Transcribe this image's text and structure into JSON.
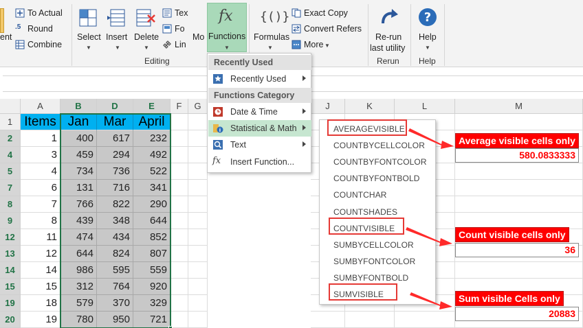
{
  "ribbon": {
    "left_group": {
      "to_actual": "To Actual",
      "round": "Round",
      "combine": "Combine",
      "cut_label": "ent"
    },
    "editing": {
      "select": "Select",
      "insert": "Insert",
      "delete": "Delete",
      "text": "Tex",
      "format": "Fo",
      "link": "Lin",
      "more": "Mo",
      "functions": "Functions",
      "group_label": "Editing"
    },
    "formulas": {
      "label": "Formulas",
      "exact_copy": "Exact Copy",
      "convert_refs": "Convert Refers",
      "more": "More"
    },
    "rerun": {
      "label_line1": "Re-run",
      "label_line2": "last utility",
      "group_label": "Rerun"
    },
    "help": {
      "label": "Help",
      "group_label": "Help"
    }
  },
  "columns": [
    "A",
    "B",
    "D",
    "E",
    "F",
    "G",
    "J",
    "K",
    "L",
    "M"
  ],
  "table": {
    "headers": [
      "Items",
      "Jan",
      "Mar",
      "April"
    ],
    "row_numbers": [
      "1",
      "2",
      "4",
      "5",
      "7",
      "8",
      "9",
      "12",
      "13",
      "14",
      "15",
      "19",
      "20"
    ],
    "rows": [
      [
        "1",
        "400",
        "617",
        "232"
      ],
      [
        "3",
        "459",
        "294",
        "492"
      ],
      [
        "4",
        "734",
        "736",
        "522"
      ],
      [
        "6",
        "131",
        "716",
        "341"
      ],
      [
        "7",
        "766",
        "822",
        "290"
      ],
      [
        "8",
        "439",
        "348",
        "644"
      ],
      [
        "11",
        "474",
        "434",
        "852"
      ],
      [
        "12",
        "644",
        "824",
        "807"
      ],
      [
        "14",
        "986",
        "595",
        "559"
      ],
      [
        "15",
        "312",
        "764",
        "920"
      ],
      [
        "18",
        "579",
        "370",
        "329"
      ],
      [
        "19",
        "780",
        "950",
        "721"
      ]
    ]
  },
  "menu": {
    "recently_used_header": "Recently Used",
    "recently_used_item": "Recently Used",
    "category_header": "Functions Category",
    "date_time": "Date & Time",
    "stat_math": "Statistical & Math",
    "text": "Text",
    "insert_function": "Insert Function..."
  },
  "submenu": {
    "items": [
      "AVERAGEVISIBLE",
      "COUNTBYCELLCOLOR",
      "COUNTBYFONTCOLOR",
      "COUNTBYFONTBOLD",
      "COUNTCHAR",
      "COUNTSHADES",
      "COUNTVISIBLE",
      "SUMBYCELLCOLOR",
      "SUMBYFONTCOLOR",
      "SUMBYFONTBOLD",
      "SUMVISIBLE"
    ]
  },
  "callouts": {
    "average": {
      "label": "Average visible cells only",
      "value": "580.0833333"
    },
    "count": {
      "label": "Count visible cells only",
      "value": "36"
    },
    "sum": {
      "label": "Sum visible Cells only",
      "value": "20883"
    }
  },
  "colors": {
    "header_fill": "#00b0f0",
    "selected_fill": "#c8c8c8",
    "accent_green": "#217346",
    "callout_red": "#ff0000"
  }
}
